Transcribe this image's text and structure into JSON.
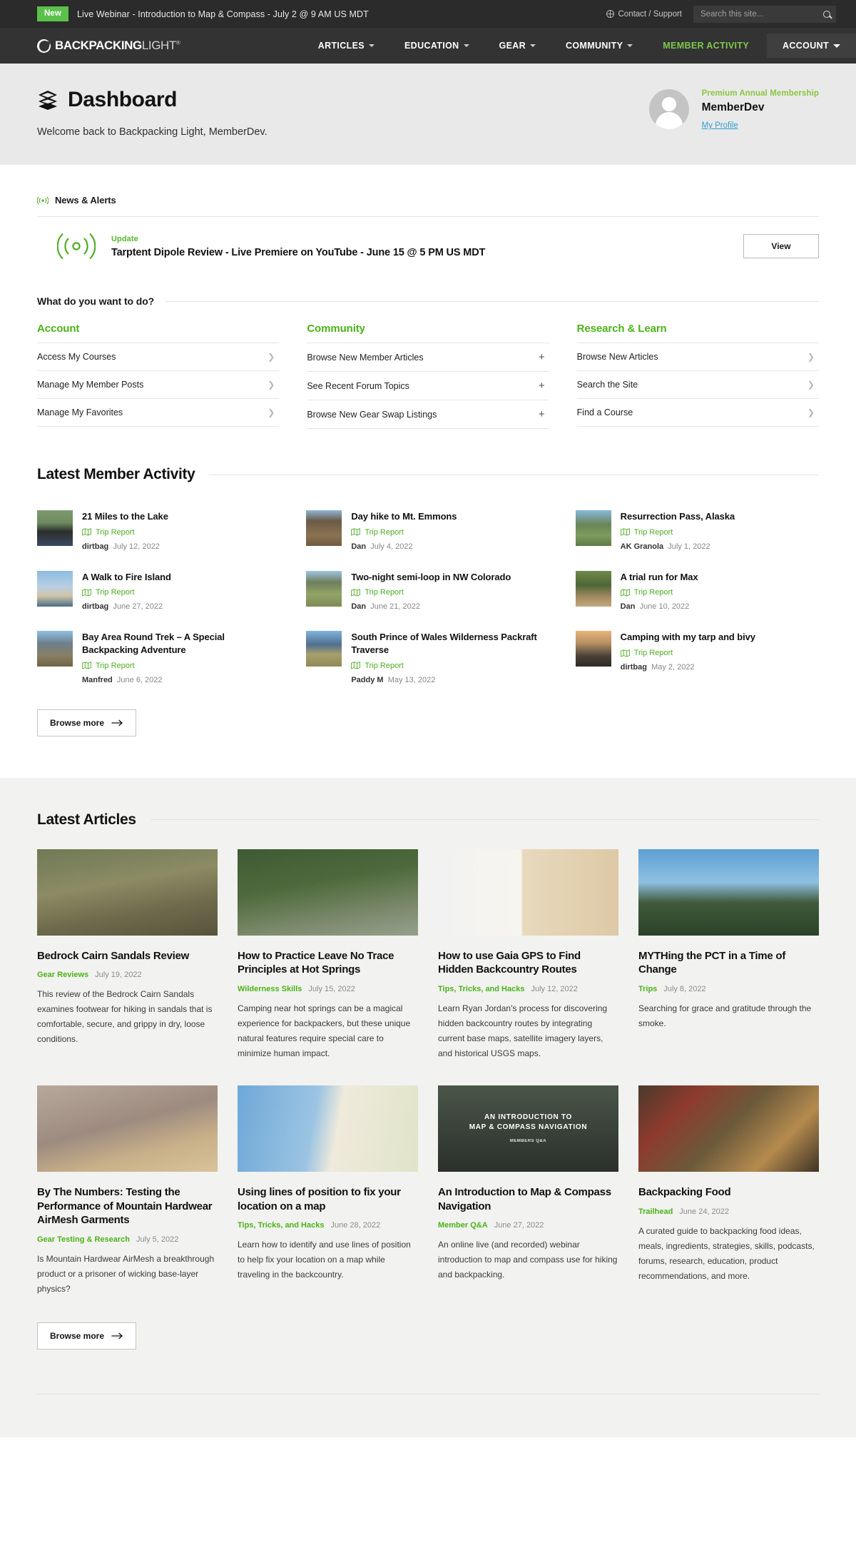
{
  "topbar": {
    "badge": "New",
    "message": "Live Webinar - Introduction to Map & Compass - July 2 @ 9 AM US MDT",
    "contact": "Contact / Support",
    "search_placeholder": "Search this site...",
    "accent_green": "#5cc14a"
  },
  "nav": {
    "logo_bold": "BACKPACKING",
    "logo_light": "LIGHT",
    "logo_tm": "®",
    "items": [
      {
        "label": "ARTICLES",
        "has_caret": true,
        "accent": false,
        "boxed": false
      },
      {
        "label": "EDUCATION",
        "has_caret": true,
        "accent": false,
        "boxed": false
      },
      {
        "label": "GEAR",
        "has_caret": true,
        "accent": false,
        "boxed": false
      },
      {
        "label": "COMMUNITY",
        "has_caret": true,
        "accent": false,
        "boxed": false
      },
      {
        "label": "MEMBER ACTIVITY",
        "has_caret": false,
        "accent": true,
        "boxed": false
      },
      {
        "label": "ACCOUNT",
        "has_caret": true,
        "accent": false,
        "boxed": true
      }
    ]
  },
  "hero": {
    "title": "Dashboard",
    "welcome": "Welcome back to Backpacking Light, MemberDev.",
    "membership_tier": "Premium Annual Membership",
    "member_name": "MemberDev",
    "profile_link": "My Profile"
  },
  "news": {
    "heading": "News & Alerts",
    "item": {
      "kicker": "Update",
      "title": "Tarptent Dipole Review - Live Premiere on YouTube - June 15 @ 5 PM US MDT",
      "button": "View"
    }
  },
  "wdywtd": {
    "heading": "What do you want to do?",
    "columns": [
      {
        "title": "Account",
        "marker": "chevron",
        "rows": [
          "Access My Courses",
          "Manage My Member Posts",
          "Manage My Favorites"
        ]
      },
      {
        "title": "Community",
        "marker": "plus",
        "rows": [
          "Browse New Member Articles",
          "See Recent Forum Topics",
          "Browse New Gear Swap Listings"
        ]
      },
      {
        "title": "Research & Learn",
        "marker": "chevron",
        "rows": [
          "Browse New Articles",
          "Search the Site",
          "Find a Course"
        ]
      }
    ]
  },
  "activity": {
    "heading": "Latest Member Activity",
    "browse_more": "Browse more",
    "items": [
      {
        "title": "21 Miles to the Lake",
        "type": "Trip Report",
        "author": "dirtbag",
        "date": "July 12, 2022",
        "thumb": "linear-gradient(180deg,#7d9a6e 0%,#6d8a60 35%,#2c2e2b 60%,#3a4a63 100%)"
      },
      {
        "title": "Day hike to Mt. Emmons",
        "type": "Trip Report",
        "author": "Dan",
        "date": "July 4, 2022",
        "thumb": "linear-gradient(180deg,#8fb6d8 0%,#6b5a45 30%,#8a7352 70%,#6e5c41 100%)"
      },
      {
        "title": "Resurrection Pass, Alaska",
        "type": "Trip Report",
        "author": "AK Granola",
        "date": "July 1, 2022",
        "thumb": "linear-gradient(180deg,#86b8de 0%,#6a8456 40%,#7d9c5e 70%,#5e7a48 100%)"
      },
      {
        "title": "A Walk to Fire Island",
        "type": "Trip Report",
        "author": "dirtbag",
        "date": "June 27, 2022",
        "thumb": "linear-gradient(180deg,#8cbce0 0%,#b9cfe2 45%,#cfc4a6 70%,#4b6d86 100%)"
      },
      {
        "title": "Two-night semi-loop in NW Colorado",
        "type": "Trip Report",
        "author": "Dan",
        "date": "June 21, 2022",
        "thumb": "linear-gradient(180deg,#9fc4e2 0%,#6d7f5c 32%,#93a468 65%,#7d8a55 100%)"
      },
      {
        "title": "A trial run for Max",
        "type": "Trip Report",
        "author": "Dan",
        "date": "June 10, 2022",
        "thumb": "linear-gradient(180deg,#6d8a4c 0%,#4f6638 40%,#a78c62 75%,#c2a87e 100%)"
      },
      {
        "title": "Bay Area Round Trek – A Special Backpacking Adventure",
        "type": "Trip Report",
        "author": "Manfred",
        "date": "June 6, 2022",
        "thumb": "linear-gradient(180deg,#8fc0e4 0%,#6d7f8c 35%,#8a7f62 70%,#6e6348 100%)"
      },
      {
        "title": "South Prince of Wales Wilderness Packraft Traverse",
        "type": "Trip Report",
        "author": "Paddy M",
        "date": "May 13, 2022",
        "thumb": "linear-gradient(180deg,#7fb4dd 0%,#4f6f8e 38%,#a8a06c 66%,#8e8a58 100%)"
      },
      {
        "title": "Camping with my tarp and bivy",
        "type": "Trip Report",
        "author": "dirtbag",
        "date": "May 2, 2022",
        "thumb": "linear-gradient(180deg,#e7b57a 0%,#b58f63 35%,#4a4238 70%,#2e2a24 100%)"
      }
    ]
  },
  "articles": {
    "heading": "Latest Articles",
    "browse_more": "Browse more",
    "items": [
      {
        "title": "Bedrock Cairn Sandals Review",
        "category": "Gear Reviews",
        "date": "July 19, 2022",
        "excerpt": "This review of the Bedrock Cairn Sandals examines footwear for hiking in sandals that is comfortable, secure, and grippy in dry, loose conditions.",
        "img": "linear-gradient(170deg,#6f7a55 0%,#8c8b64 40%,#6d6a4c 70%,#57543c 100%)"
      },
      {
        "title": "How to Practice Leave No Trace Principles at Hot Springs",
        "category": "Wilderness Skills",
        "date": "July 15, 2022",
        "excerpt": "Camping near hot springs can be a magical experience for backpackers, but these unique natural features require special care to minimize human impact.",
        "img": "linear-gradient(170deg,#3f5a34 0%,#4e6a3c 40%,#7d8a6d 75%,#96a08c 100%)"
      },
      {
        "title": "How to use Gaia GPS to Find Hidden Backcountry Routes",
        "category": "Tips, Tricks, and Hacks",
        "date": "July 12, 2022",
        "excerpt": "Learn Ryan Jordan's process for discovering hidden backcountry routes by integrating current base maps, satellite imagery layers, and historical USGS maps.",
        "img": "linear-gradient(90deg,#f2f2f2 0%,#f7f5ef 46%,#e8d9bd 47%,#ddc9a5 100%)"
      },
      {
        "title": "MYTHing the PCT in a Time of Change",
        "category": "Trips",
        "date": "July 8, 2022",
        "excerpt": "Searching for grace and gratitude through the smoke.",
        "img": "linear-gradient(180deg,#5d9fd4 0%,#8fc0e2 38%,#3f5a3a 62%,#2c4229 100%)"
      },
      {
        "title": "By The Numbers: Testing the Performance of Mountain Hardwear AirMesh Garments",
        "category": "Gear Testing & Research",
        "date": "July 5, 2022",
        "excerpt": "Is Mountain Hardwear AirMesh a breakthrough product or a prisoner of wicking base-layer physics?",
        "img": "linear-gradient(165deg,#b8a89c 0%,#9d8b80 45%,#c8b089 72%,#d8c39a 100%)"
      },
      {
        "title": "Using lines of position to fix your location on a map",
        "category": "Tips, Tricks, and Hacks",
        "date": "June 28, 2022",
        "excerpt": "Learn how to identify and use lines of position to help fix your location on a map while traveling in the backcountry.",
        "img": "linear-gradient(100deg,#6ea8d8 0%,#9cc4e2 42%,#efeadc 55%,#dfe4c8 100%)"
      },
      {
        "title": "An Introduction to Map & Compass Navigation",
        "category": "Member Q&A",
        "date": "June 27, 2022",
        "excerpt": "An online live (and recorded) webinar introduction to map and compass use for hiking and backpacking.",
        "img": "linear-gradient(180deg,#4a5548 0%,#3a423a 50%,#2b302b 100%)",
        "overlay_line1": "AN INTRODUCTION TO",
        "overlay_line2": "MAP & COMPASS NAVIGATION",
        "overlay_line3": "MEMBERS Q&A"
      },
      {
        "title": "Backpacking Food",
        "category": "Trailhead",
        "date": "June 24, 2022",
        "excerpt": "A curated guide to backpacking food ideas, meals, ingredients, strategies, skills, podcasts, forums, research, education, product recommendations, and more.",
        "img": "linear-gradient(135deg,#4a3a2c 0%,#8e3b2e 25%,#6b5a3a 50%,#b58a4e 75%,#3e3326 100%)"
      }
    ]
  }
}
